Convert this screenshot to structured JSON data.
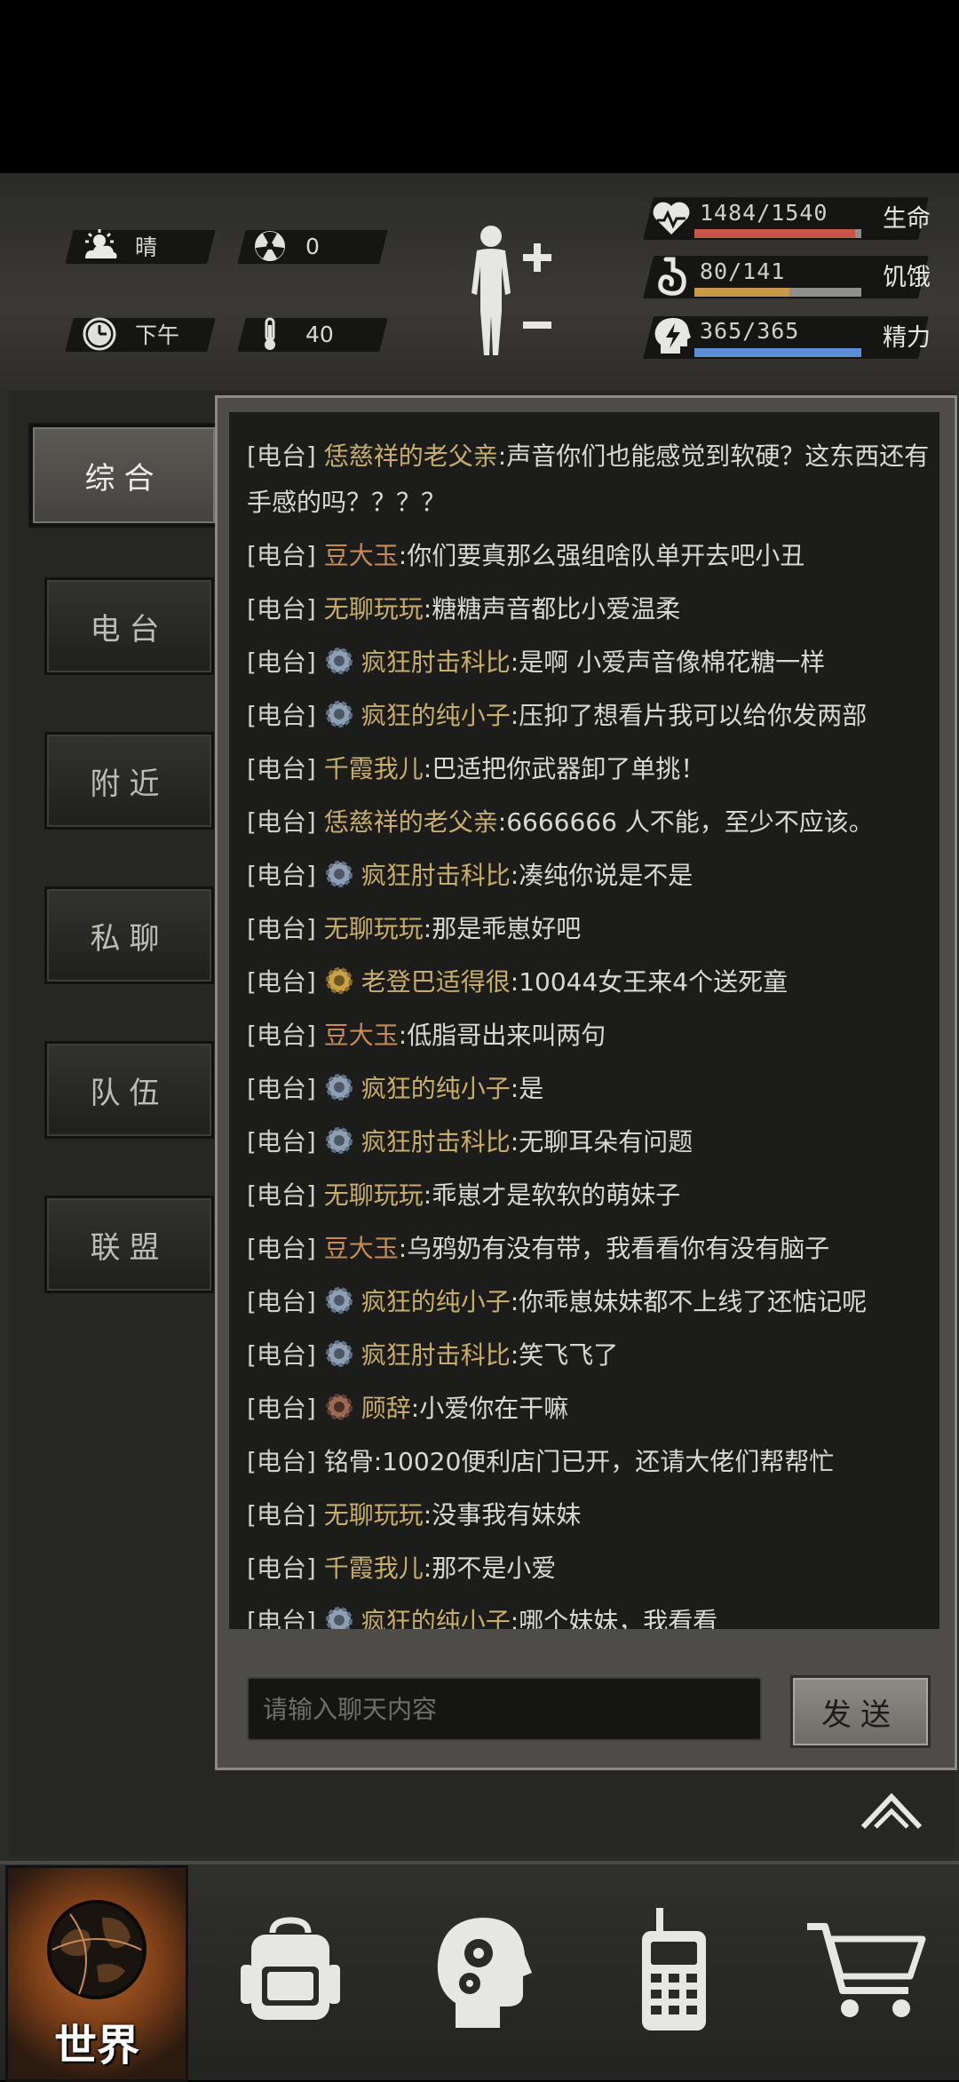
{
  "status": {
    "weather": {
      "label": "晴",
      "icon": "sun-cloud-icon"
    },
    "radiation": {
      "value": "0",
      "icon": "radiation-icon"
    },
    "time": {
      "label": "下午",
      "icon": "clock-icon"
    },
    "temperature": {
      "value": "40",
      "icon": "thermometer-icon"
    },
    "body_icon": "body-figure-icon",
    "health": {
      "value": "1484/1540",
      "label": "生命",
      "fraction": 0.9636,
      "color": "#c8554a"
    },
    "hunger": {
      "value": "80/141",
      "label": "饥饿",
      "fraction": 0.567,
      "color": "#c99a45"
    },
    "energy": {
      "value": "365/365",
      "label": "精力",
      "fraction": 1.0,
      "color": "#5a8fd6"
    }
  },
  "tabs": [
    {
      "label": "综合",
      "active": true
    },
    {
      "label": "电台",
      "active": false
    },
    {
      "label": "附近",
      "active": false
    },
    {
      "label": "私聊",
      "active": false
    },
    {
      "label": "队伍",
      "active": false
    },
    {
      "label": "联盟",
      "active": false
    }
  ],
  "chat": {
    "channel": "[电台]",
    "messages": [
      {
        "name": "恁慈祥的老父亲",
        "text": ":声音你们也能感觉到软硬？这东西还有手感的吗？？？？",
        "badge": "",
        "color": "gold"
      },
      {
        "name": "豆大玉",
        "text": ":你们要真那么强组啥队单开去吧小丑",
        "badge": "",
        "color": "red"
      },
      {
        "name": "无聊玩玩",
        "text": ":糖糖声音都比小爱温柔",
        "badge": "",
        "color": "gold"
      },
      {
        "name": "疯狂肘击科比",
        "text": ":是啊 小爱声音像棉花糖一样",
        "badge": "gear",
        "color": "gold"
      },
      {
        "name": "疯狂的纯小子",
        "text": ":压抑了想看片我可以给你发两部",
        "badge": "gear",
        "color": "gold"
      },
      {
        "name": "千霞我儿",
        "text": ":巴适把你武器卸了单挑！",
        "badge": "",
        "color": "gold"
      },
      {
        "name": "恁慈祥的老父亲",
        "text": ":6666666 人不能，至少不应该。",
        "badge": "",
        "color": "gold"
      },
      {
        "name": "疯狂肘击科比",
        "text": ":凑纯你说是不是",
        "badge": "gear",
        "color": "gold"
      },
      {
        "name": "无聊玩玩",
        "text": ":那是乖崽好吧",
        "badge": "",
        "color": "gold"
      },
      {
        "name": "老登巴适得很",
        "text": ":10044女王来4个送死童",
        "badge": "gold-gear",
        "color": "gold"
      },
      {
        "name": "豆大玉",
        "text": ":低脂哥出来叫两句",
        "badge": "",
        "color": "red"
      },
      {
        "name": "疯狂的纯小子",
        "text": ":是",
        "badge": "gear",
        "color": "gold"
      },
      {
        "name": "疯狂肘击科比",
        "text": ":无聊耳朵有问题",
        "badge": "gear",
        "color": "gold"
      },
      {
        "name": "无聊玩玩",
        "text": ":乖崽才是软软的萌妹子",
        "badge": "",
        "color": "gold"
      },
      {
        "name": "豆大玉",
        "text": ":乌鸦奶有没有带，我看看你有没有脑子",
        "badge": "",
        "color": "red"
      },
      {
        "name": "疯狂的纯小子",
        "text": ":你乖崽妹妹都不上线了还惦记呢",
        "badge": "gear",
        "color": "gold"
      },
      {
        "name": "疯狂肘击科比",
        "text": ":笑飞飞了",
        "badge": "gear",
        "color": "gold"
      },
      {
        "name": "顾辞",
        "text": ":小爱你在干嘛",
        "badge": "bronze-gear",
        "color": "gold"
      },
      {
        "name": "铭骨",
        "text": ":10020便利店门已开，还请大佬们帮帮忙",
        "badge": "",
        "color": "gray"
      },
      {
        "name": "无聊玩玩",
        "text": ":没事我有妹妹",
        "badge": "",
        "color": "gold"
      },
      {
        "name": "千霞我儿",
        "text": ":那不是小爱",
        "badge": "",
        "color": "gold"
      },
      {
        "name": "疯狂的纯小子",
        "text": ":哪个妹妹，我看看",
        "badge": "gear",
        "color": "gold"
      }
    ],
    "input_placeholder": "请输入聊天内容",
    "send_label": "发送"
  },
  "nav": {
    "world_label": "世界",
    "items": [
      "globe-icon",
      "backpack-icon",
      "head-gears-icon",
      "walkie-talkie-icon",
      "cart-icon"
    ]
  }
}
